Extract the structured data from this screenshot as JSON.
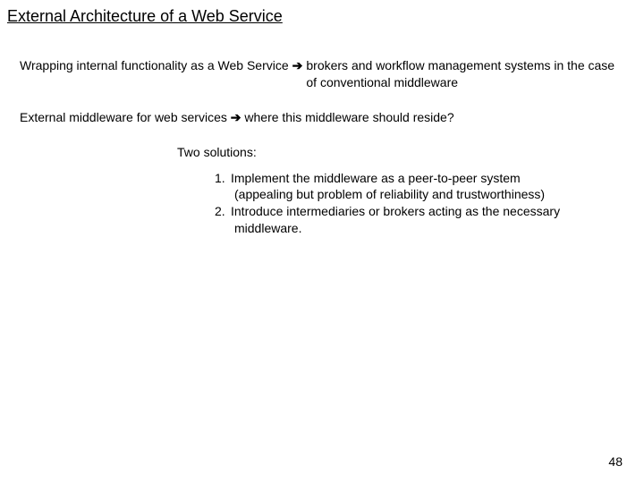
{
  "title": "External Architecture of a Web Service",
  "arrow": "➔",
  "point1": {
    "lhs": "Wrapping internal functionality as a Web Service ",
    "rhs": " brokers and workflow management systems in the case of conventional middleware"
  },
  "point2": {
    "lhs": "External middleware for web services ",
    "rhs": " where this middleware should reside?"
  },
  "solutions": {
    "heading": "Two solutions:",
    "items": [
      {
        "num": "1.",
        "text": "Implement the middleware as a peer-to-peer system",
        "sub": "(appealing but problem of reliability and trustworthiness)"
      },
      {
        "num": "2.",
        "text": "Introduce intermediaries or brokers acting as the necessary",
        "sub": "middleware."
      }
    ]
  },
  "page": "48"
}
